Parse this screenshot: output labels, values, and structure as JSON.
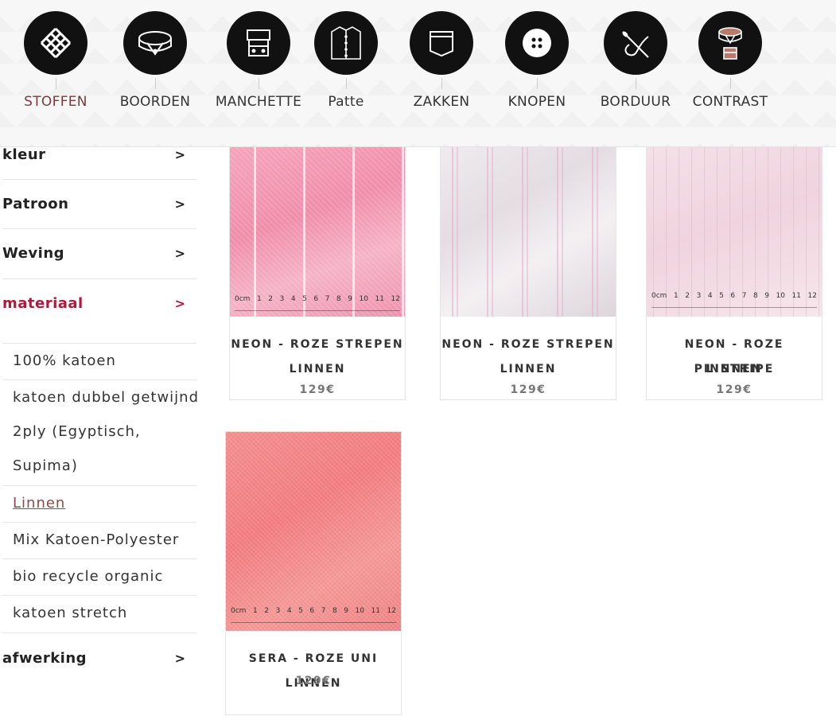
{
  "nav": [
    {
      "label": "STOFFEN",
      "icon": "fabric-weave-icon",
      "active": true
    },
    {
      "label": "BOORDEN",
      "icon": "collar-icon",
      "active": false
    },
    {
      "label": "MANCHETTE",
      "icon": "cuff-icon",
      "active": false
    },
    {
      "label": "Patte",
      "icon": "shirt-placket-icon",
      "active": false
    },
    {
      "label": "ZAKKEN",
      "icon": "pocket-icon",
      "active": false
    },
    {
      "label": "KNOPEN",
      "icon": "button-icon",
      "active": false
    },
    {
      "label": "BORDUUR",
      "icon": "embroidery-needle-icon",
      "active": false
    },
    {
      "label": "CONTRAST",
      "icon": "contrast-collar-icon",
      "active": false
    }
  ],
  "filters": {
    "kleur": "kleur",
    "patroon": "Patroon",
    "weving": "Weving",
    "materiaal": "materiaal",
    "afwerking": "afwerking",
    "arrow": ">"
  },
  "materials": [
    "100% katoen",
    "katoen dubbel getwijnd",
    "2ply (Egyptisch,",
    "Supima)",
    "Linnen",
    "Mix Katoen-Polyester",
    "bio recycle organic",
    "katoen stretch"
  ],
  "products": [
    {
      "title_line1": "NEON - ROZE STREPEN",
      "title_line2": "LINNEN",
      "price": "129€"
    },
    {
      "title_line1": "NEON - ROZE STREPEN",
      "title_line2": "LINNEN",
      "price": "129€"
    },
    {
      "title_line1": "NEON - ROZE PINSTRIPE",
      "title_line2": "LINNEN",
      "price": "129€"
    },
    {
      "title_line1": "SERA - ROZE UNI LINNEN",
      "title_line2": "",
      "price": "129€"
    }
  ],
  "ruler_marks": [
    "0cm",
    "1",
    "2",
    "3",
    "4",
    "5",
    "6",
    "7",
    "8",
    "9",
    "10",
    "11",
    "12"
  ],
  "colors": {
    "accent": "#b5163a",
    "active_nav": "#7a3b3b",
    "link": "#8a4b4b"
  }
}
